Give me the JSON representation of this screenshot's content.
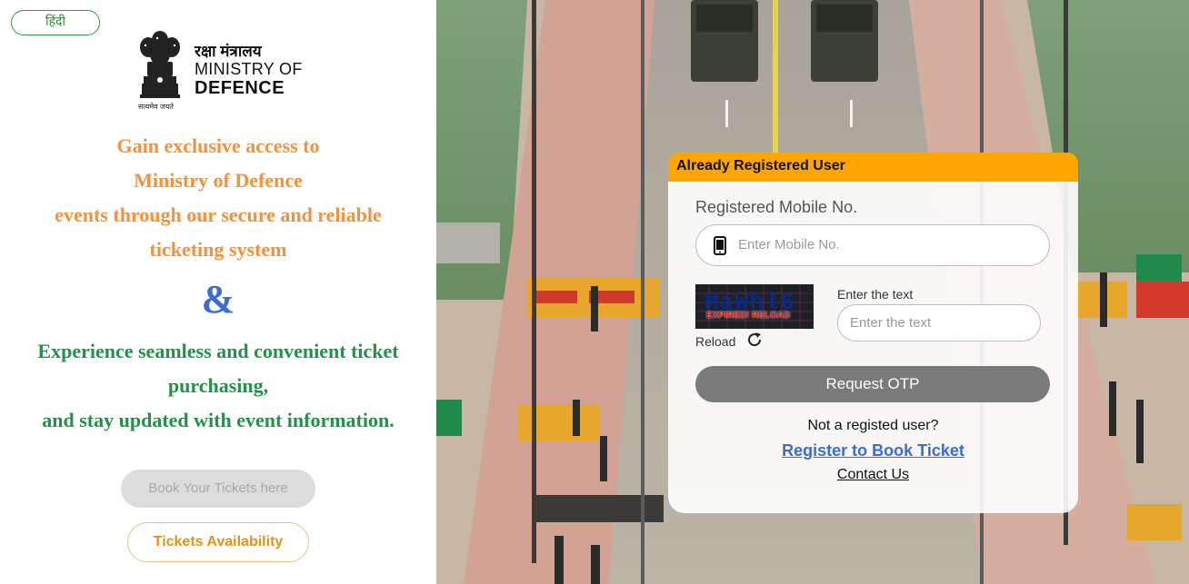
{
  "header": {
    "lang_toggle": "हिंदी"
  },
  "logo": {
    "hindi": "रक्षा मंत्रालय",
    "line1": "MINISTRY OF",
    "line2": "DEFENCE",
    "motto": "सत्यमेव जयते"
  },
  "tagline": {
    "lines": [
      "Gain exclusive access to",
      "Ministry of Defence",
      "events through our secure and reliable",
      "ticketing system"
    ],
    "ampersand": "&",
    "lines2": [
      "Experience seamless and convenient ticket",
      "purchasing,",
      "and stay updated with event information."
    ]
  },
  "buttons": {
    "book": "Book Your Tickets here",
    "availability": "Tickets Availability"
  },
  "login": {
    "header": "Already Registered User",
    "mobile_label": "Registered Mobile No.",
    "mobile_placeholder": "Enter Mobile No.",
    "captcha_text": "MaWhl6",
    "captcha_status": "EXPIRED! RELOAD",
    "reload_label": "Reload",
    "text_label": "Enter the text",
    "text_placeholder": "Enter the text",
    "otp_button": "Request OTP",
    "not_registered": "Not a registed user?",
    "register_link": "Register to Book Ticket",
    "contact_link": "Contact Us"
  },
  "colors": {
    "accent_orange": "#ffa500",
    "tag_orange": "#f0923e",
    "tag_green": "#24914a",
    "amp_blue": "#3c6bd4"
  }
}
